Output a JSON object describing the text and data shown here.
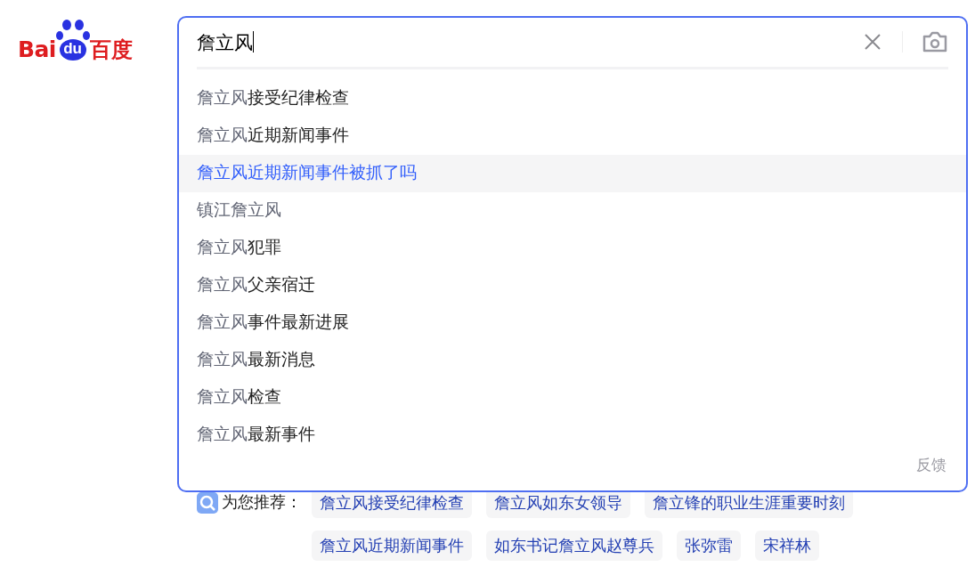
{
  "logo": {
    "latin": "Bai",
    "paw": "du",
    "chinese": "百度"
  },
  "search": {
    "value": "詹立风"
  },
  "suggestions": [
    {
      "selected": false,
      "parts": [
        {
          "kind": "query",
          "text": "詹立风"
        },
        {
          "kind": "completion",
          "text": "接受纪律检查"
        }
      ]
    },
    {
      "selected": false,
      "parts": [
        {
          "kind": "query",
          "text": "詹立风"
        },
        {
          "kind": "completion",
          "text": "近期新闻事件"
        }
      ]
    },
    {
      "selected": true,
      "parts": [
        {
          "kind": "query",
          "text": "詹立风"
        },
        {
          "kind": "completion",
          "text": "近期新闻事件被抓了吗"
        }
      ]
    },
    {
      "selected": false,
      "parts": [
        {
          "kind": "query",
          "text": "镇江詹立风"
        }
      ]
    },
    {
      "selected": false,
      "parts": [
        {
          "kind": "query",
          "text": "詹立风"
        },
        {
          "kind": "completion",
          "text": "犯罪"
        }
      ]
    },
    {
      "selected": false,
      "parts": [
        {
          "kind": "query",
          "text": "詹立风"
        },
        {
          "kind": "completion",
          "text": "父亲宿迁"
        }
      ]
    },
    {
      "selected": false,
      "parts": [
        {
          "kind": "query",
          "text": "詹立风"
        },
        {
          "kind": "completion",
          "text": "事件最新进展"
        }
      ]
    },
    {
      "selected": false,
      "parts": [
        {
          "kind": "query",
          "text": "詹立风"
        },
        {
          "kind": "completion",
          "text": "最新消息"
        }
      ]
    },
    {
      "selected": false,
      "parts": [
        {
          "kind": "query",
          "text": "詹立风"
        },
        {
          "kind": "completion",
          "text": "检查"
        }
      ]
    },
    {
      "selected": false,
      "parts": [
        {
          "kind": "query",
          "text": "詹立风"
        },
        {
          "kind": "completion",
          "text": "最新事件"
        }
      ]
    }
  ],
  "feedback": "反馈",
  "recommendations": {
    "label": "为您推荐：",
    "rows": [
      [
        "詹立风接受纪律检查",
        "詹立风如东女领导",
        "詹立锋的职业生涯重要时刻"
      ],
      [
        "詹立风近期新闻事件",
        "如东书记詹立风赵尊兵",
        "张弥雷",
        "宋祥林"
      ]
    ]
  }
}
